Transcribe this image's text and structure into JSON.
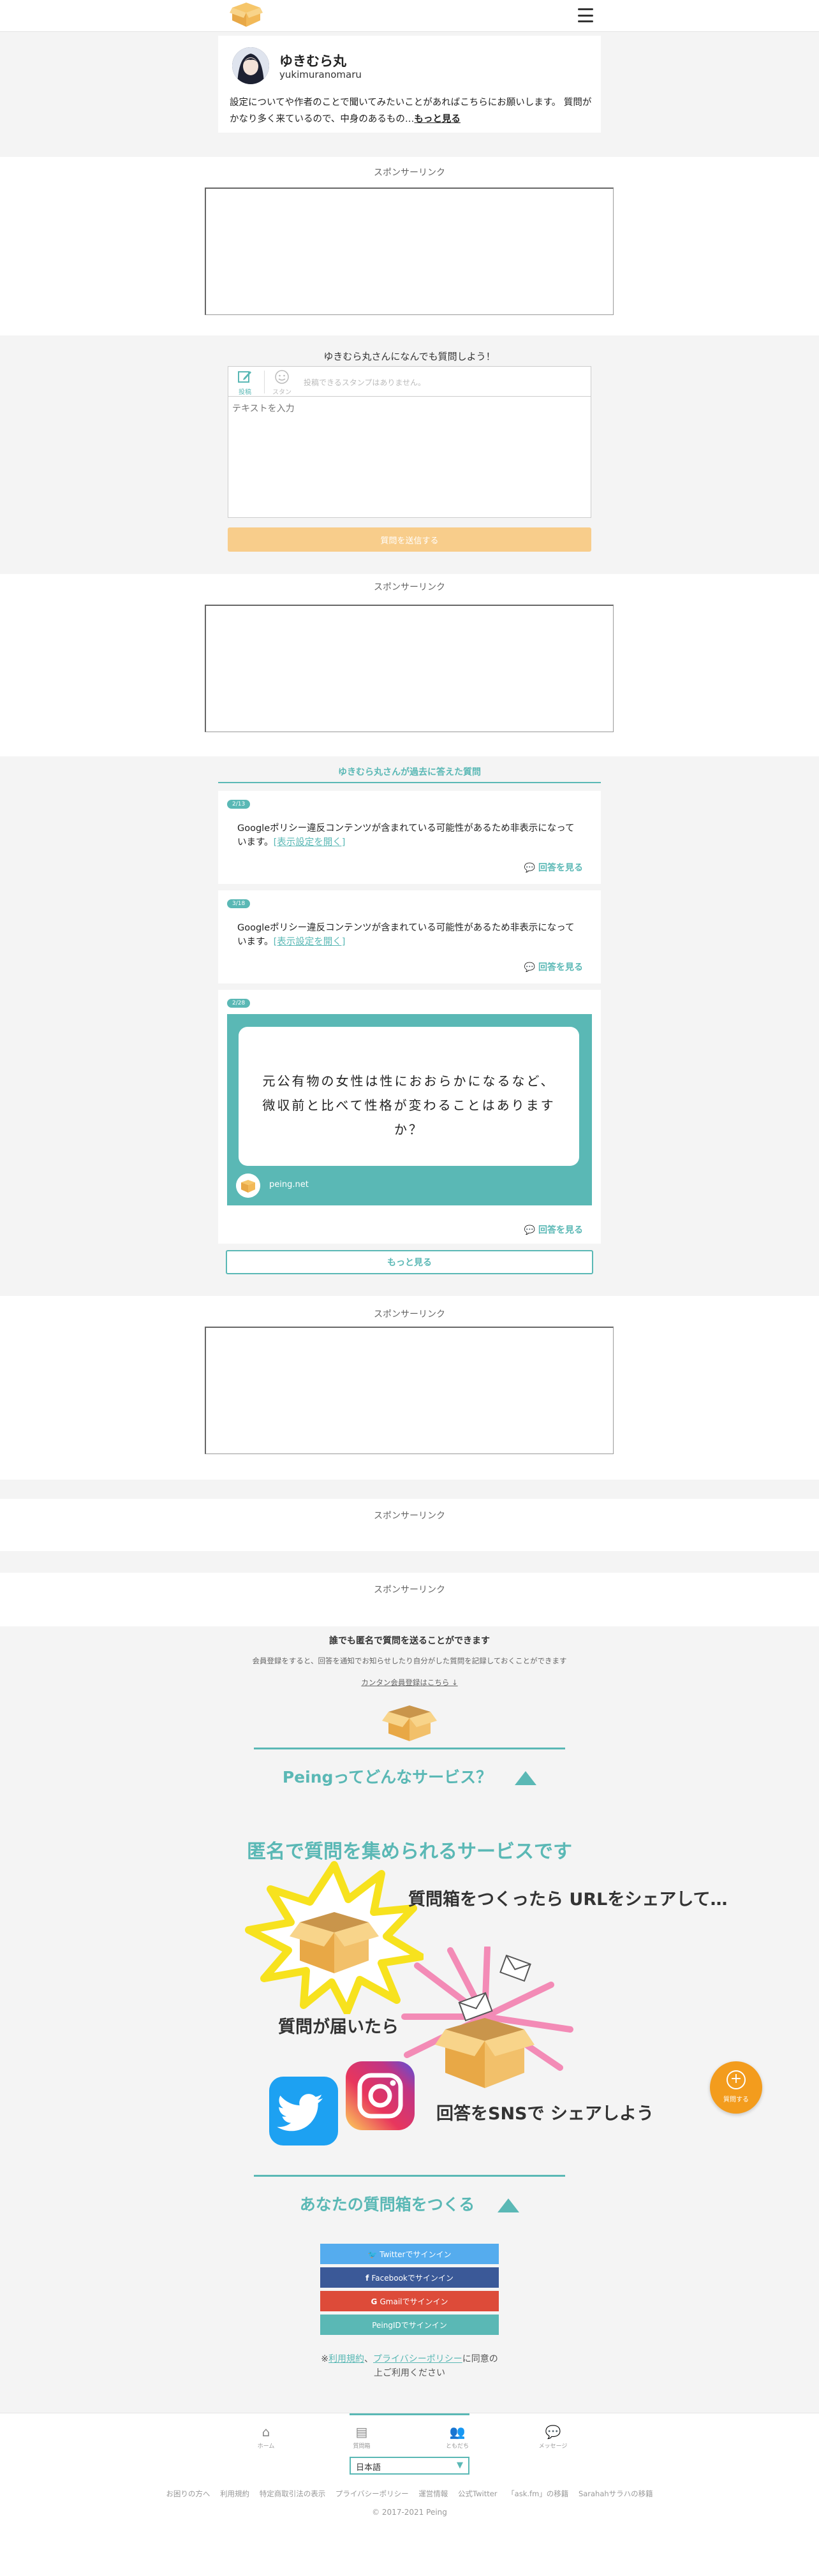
{
  "header": {
    "logo_icon": "peing-box-logo",
    "menu_icon": "hamburger-menu-icon"
  },
  "profile": {
    "name": "ゆきむら丸",
    "id": "yukimuranomaru",
    "description": "設定についてや作者のことで聞いてみたいことがあればこちらにお願いします。 質問がかなり多く来ているので、中身のあるもの…",
    "more": "もっと見る"
  },
  "sponsor_label": "スポンサーリンク",
  "ask": {
    "title": "ゆきむら丸さんになんでも質問しよう！",
    "post_label": "投稿",
    "stamp_label": "スタンプ",
    "stamp_hint": "投稿できるスタンプはありません。",
    "placeholder": "テキストを入力",
    "submit": "質問を送信する"
  },
  "past": {
    "title": "ゆきむら丸さんが過去に答えた質問",
    "questions": [
      {
        "date": "2/13",
        "text": "Googleポリシー違反コンテンツが含まれている可能性があるため非表示になっています。",
        "link": "[表示設定を開く]",
        "answer": "回答を見る"
      },
      {
        "date": "3/18",
        "text": "Googleポリシー違反コンテンツが含まれている可能性があるため非表示になっています。",
        "link": "[表示設定を開く]",
        "answer": "回答を見る"
      },
      {
        "date": "2/28",
        "image_text": "元公有物の女性は性におおらかになるなど、微収前と比べて性格が変わることはありますか？",
        "brand": "peing.net",
        "answer": "回答を見る"
      }
    ],
    "more": "もっと見る"
  },
  "signup": {
    "title": "誰でも匿名で質問を送ることができます",
    "sub": "会員登録をすると、回答を通知でお知らせしたり自分がした質問を記録しておくことができます",
    "link": "カンタン会員登録はこちら ↓"
  },
  "service": {
    "heading": "Peingってどんなサービス？",
    "tagline": "匿名で質問を集められるサービスです",
    "step1": "質問箱をつくったら URLをシェアして…",
    "step2": "質問が届いたら",
    "step3": "回答をSNSで シェアしよう"
  },
  "create": {
    "heading": "あなたの質問箱をつくる",
    "buttons": [
      {
        "label": "Twitterでサインイン",
        "color": "#55acee"
      },
      {
        "label": "Facebookでサインイン",
        "color": "#3b5998"
      },
      {
        "label": "Gmailでサインイン",
        "color": "#dd4b39"
      },
      {
        "label": "PeingIDでサインイン",
        "color": "#5ab8b5"
      }
    ],
    "agree_prefix": "※",
    "terms": "利用規約",
    "privacy": "プライバシーポリシー",
    "agree_suffix": "に同意の",
    "agree_line2": "上ご利用ください"
  },
  "fab": {
    "label": "質問する"
  },
  "footer": {
    "nav": [
      {
        "label": "ホーム",
        "icon": "home-icon"
      },
      {
        "label": "質問箱",
        "icon": "inbox-icon"
      },
      {
        "label": "ともだち",
        "icon": "friends-icon"
      },
      {
        "label": "メッセージ",
        "icon": "message-icon"
      }
    ],
    "language": "日本語",
    "links": [
      "お困りの方へ",
      "利用規約",
      "特定商取引法の表示",
      "プライバシーポリシー",
      "運営情報",
      "公式Twitter",
      "「ask.fm」の移籍",
      "Sarahahサラハの移籍"
    ],
    "copyright": "© 2017-2021 Peing"
  },
  "colors": {
    "accent": "#5ab8b5",
    "orange": "#f39c1d",
    "submit_disabled": "#f8cd8b"
  }
}
